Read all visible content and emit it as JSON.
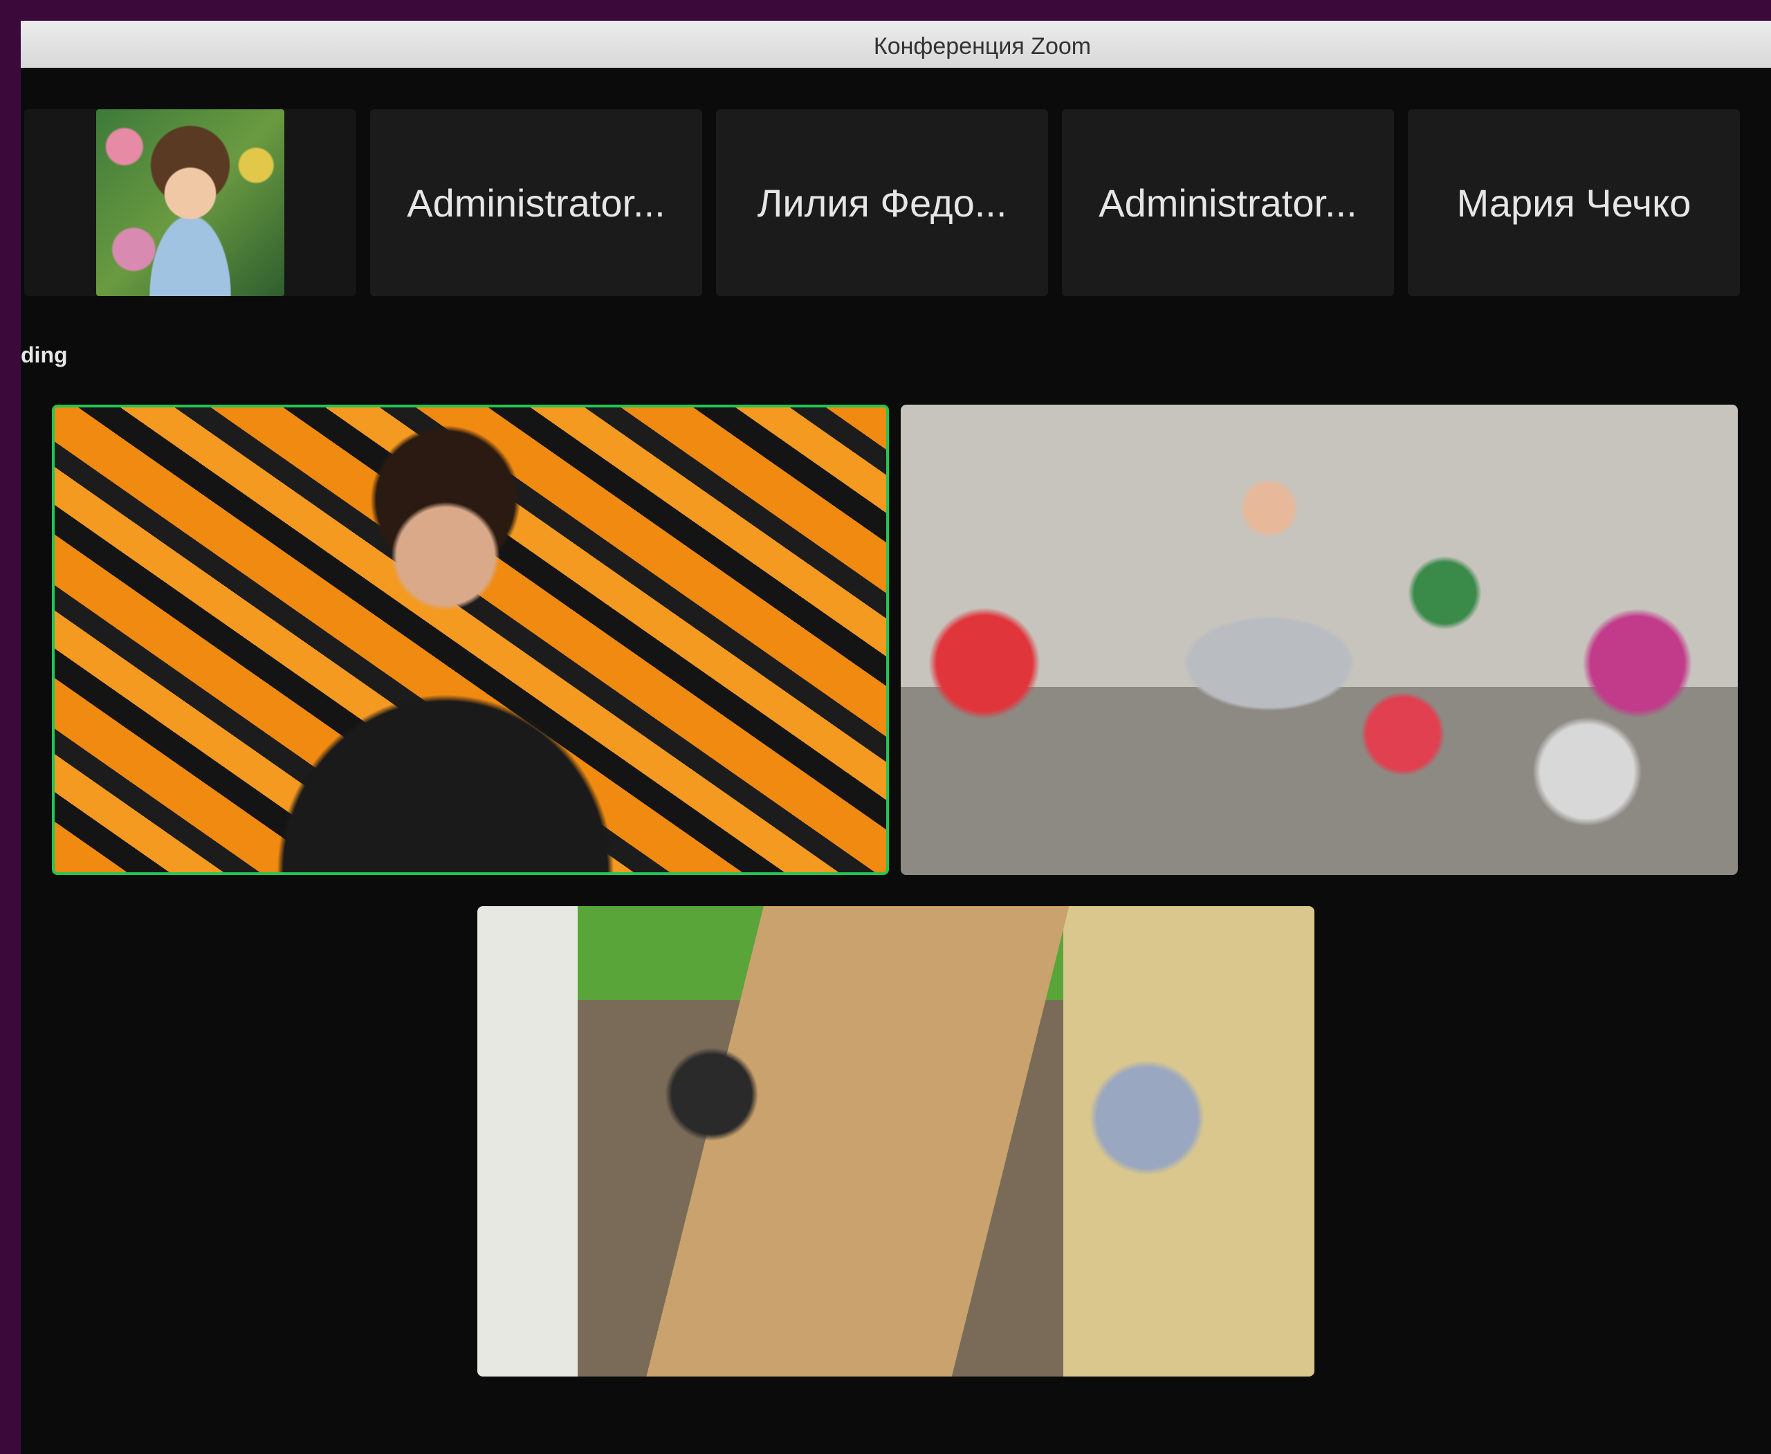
{
  "window": {
    "title": "Конференция Zoom"
  },
  "participants_strip": [
    {
      "name": "",
      "type": "video"
    },
    {
      "name": "Administrator..."
    },
    {
      "name": "Лилия Федо..."
    },
    {
      "name": "Administrator..."
    },
    {
      "name": "Мария Чечко"
    }
  ],
  "status": {
    "recording_text": "ding"
  },
  "colors": {
    "active_speaker_border": "#23c552"
  }
}
